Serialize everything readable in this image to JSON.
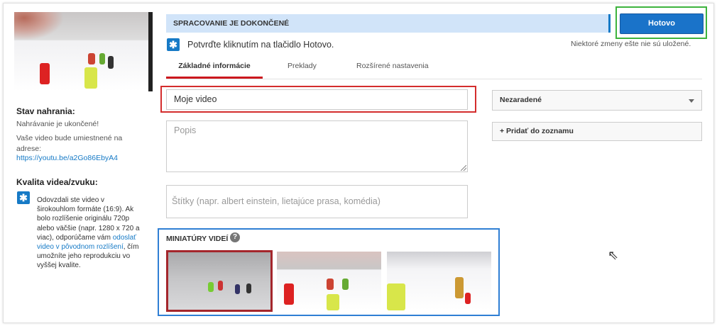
{
  "header": {
    "status": "SPRACOVANIE JE DOKONČENÉ",
    "done_button": "Hotovo",
    "confirm_text": "Potvrďte kliknutím na tlačidlo Hotovo.",
    "unsaved_text": "Niektoré zmeny ešte nie sú uložené."
  },
  "tabs": [
    {
      "label": "Základné informácie",
      "active": true
    },
    {
      "label": "Preklady",
      "active": false
    },
    {
      "label": "Rozšírené nastavenia",
      "active": false
    }
  ],
  "sidebar": {
    "upload_status_title": "Stav nahrania:",
    "upload_done": "Nahrávanie je ukončené!",
    "location_text": "Vaše video bude umiestnené na adrese:",
    "video_url": "https://youtu.be/a2Go86EbyA4",
    "quality_title": "Kvalita videa/zvuku:",
    "quality_text_1": "Odovzdali ste video v širokouhlom formáte (16:9). Ak bolo rozlíšenie originálu 720p alebo väčšie (napr. 1280 x 720 a viac), odporúčame vám ",
    "quality_link": "odoslať video v pôvodnom rozlíšení",
    "quality_text_2": ", čím umožníte jeho reprodukciu vo vyššej kvalite."
  },
  "form": {
    "title_value": "Moje video",
    "description_placeholder": "Popis",
    "tags_placeholder": "Štítky (napr. albert einstein, lietajúce prasa, komédia)",
    "privacy_select": "Nezaradené",
    "playlist_button": "+ Pridať do zoznamu"
  },
  "thumbnails": {
    "label": "MINIATÚRY VIDEÍ",
    "help": "?",
    "count": 3,
    "selected_index": 0
  },
  "colors": {
    "accent_blue": "#167ac6",
    "status_bg": "#d1e4f9",
    "tab_active": "#cc181e",
    "highlight_red": "#d42d2d",
    "highlight_green": "#3db33d",
    "highlight_blue": "#2f7fd4"
  }
}
